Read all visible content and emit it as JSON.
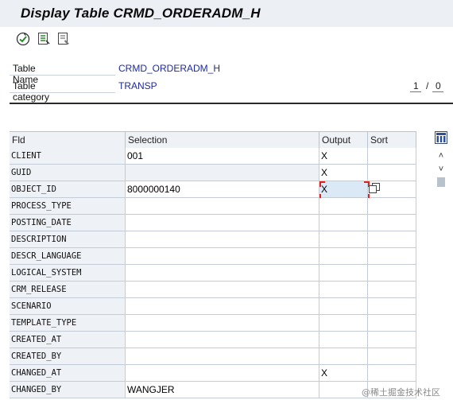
{
  "window": {
    "title": "Display Table CRMD_ORDERADM_H"
  },
  "toolbar": {
    "icons": [
      "execute-icon",
      "field-list-icon",
      "document-detail-icon"
    ]
  },
  "selection_header": {
    "table_name_label": "Table Name",
    "table_name_value": "CRMD_ORDERADM_H",
    "table_category_label": "Table category",
    "table_category_value": "TRANSP",
    "page_current": "1",
    "page_separator": "/",
    "page_total": "0"
  },
  "grid": {
    "columns": {
      "fld": "Fld",
      "selection": "Selection",
      "output": "Output",
      "sort": "Sort"
    },
    "rows": [
      {
        "fld": "CLIENT",
        "selection": "001",
        "output": "X",
        "sort": ""
      },
      {
        "fld": "GUID",
        "selection": "",
        "output": "X",
        "sort": ""
      },
      {
        "fld": "OBJECT_ID",
        "selection": "8000000140",
        "output": "X",
        "sort": ""
      },
      {
        "fld": "PROCESS_TYPE",
        "selection": "",
        "output": "",
        "sort": ""
      },
      {
        "fld": "POSTING_DATE",
        "selection": "",
        "output": "",
        "sort": ""
      },
      {
        "fld": "DESCRIPTION",
        "selection": "",
        "output": "",
        "sort": ""
      },
      {
        "fld": "DESCR_LANGUAGE",
        "selection": "",
        "output": "",
        "sort": ""
      },
      {
        "fld": "LOGICAL_SYSTEM",
        "selection": "",
        "output": "",
        "sort": ""
      },
      {
        "fld": "CRM_RELEASE",
        "selection": "",
        "output": "",
        "sort": ""
      },
      {
        "fld": "SCENARIO",
        "selection": "",
        "output": "",
        "sort": ""
      },
      {
        "fld": "TEMPLATE_TYPE",
        "selection": "",
        "output": "",
        "sort": ""
      },
      {
        "fld": "CREATED_AT",
        "selection": "",
        "output": "",
        "sort": ""
      },
      {
        "fld": "CREATED_BY",
        "selection": "",
        "output": "",
        "sort": ""
      },
      {
        "fld": "CHANGED_AT",
        "selection": "",
        "output": "X",
        "sort": ""
      },
      {
        "fld": "CHANGED_BY",
        "selection": "WANGJER",
        "output": "",
        "sort": ""
      }
    ]
  },
  "scroll": {
    "up_glyph": "˄",
    "down_glyph": "˅"
  },
  "watermark": "@稀土掘金技术社区",
  "colors": {
    "title_bg": "#eceff4",
    "value_blue": "#1e2a9c",
    "focus_red": "#dd2222",
    "header_bg": "#eef1f5"
  }
}
